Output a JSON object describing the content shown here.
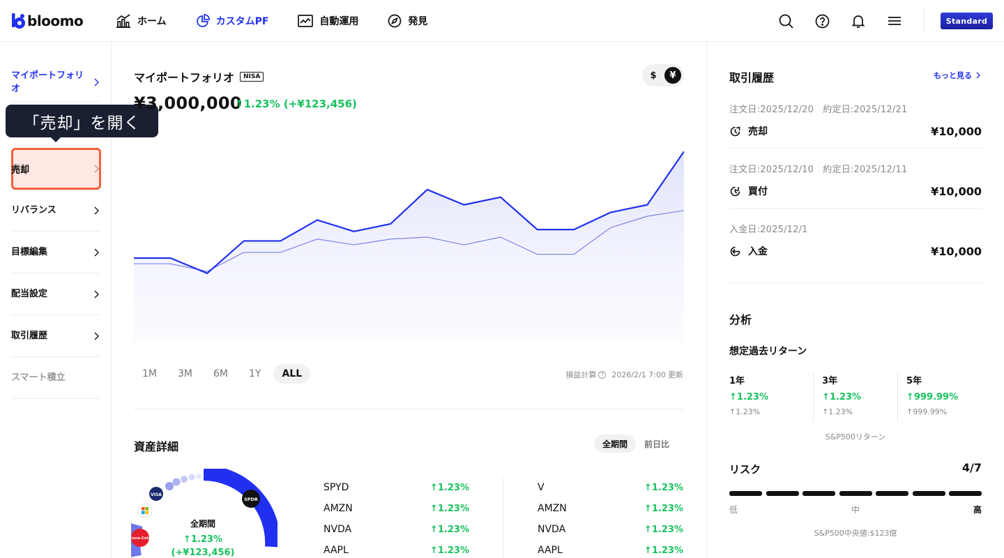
{
  "header": {
    "logo": "bloomo",
    "nav": [
      {
        "label": "ホーム",
        "icon": "home-chart-icon"
      },
      {
        "label": "カスタムPF",
        "icon": "pie-chart-icon",
        "active": true
      },
      {
        "label": "自動運用",
        "icon": "line-chart-icon"
      },
      {
        "label": "発見",
        "icon": "compass-icon"
      }
    ],
    "icons": [
      "search-icon",
      "help-icon",
      "bell-icon",
      "menu-icon"
    ],
    "plan": "Standard"
  },
  "sidebar": {
    "items": [
      {
        "label": "マイポートフォリオ",
        "state": "active"
      },
      {
        "label": "売却",
        "state": "highlighted"
      },
      {
        "label": "リバランス"
      },
      {
        "label": "目標編集"
      },
      {
        "label": "配当設定"
      },
      {
        "label": "取引履歴"
      },
      {
        "label": "スマート積立",
        "state": "disabled"
      }
    ],
    "tooltip": "「売却」を開く"
  },
  "portfolio": {
    "title": "マイポートフォリオ",
    "badge": "NISA",
    "currency": {
      "usd": "$",
      "jpy": "¥",
      "selected": "¥"
    },
    "value": "¥3,000,000",
    "change": "1.23% (+¥123,456)",
    "ranges": [
      "1M",
      "3M",
      "6M",
      "1Y",
      "ALL"
    ],
    "selected_range": "ALL",
    "pl_label": "損益計算",
    "updated": "2026/2/1 7:00",
    "updated_suffix": "更新"
  },
  "chart_data": {
    "type": "line",
    "series": [
      {
        "name": "portfolio",
        "color": "#2130f0",
        "values": [
          44,
          44,
          36,
          53,
          53,
          64,
          58,
          62,
          80,
          72,
          76,
          59,
          59,
          68,
          72,
          100
        ]
      },
      {
        "name": "benchmark",
        "color": "#7b83e6",
        "values": [
          41,
          41,
          37,
          47,
          47,
          54,
          51,
          54,
          55,
          51,
          55,
          46,
          46,
          60,
          66,
          69
        ]
      }
    ],
    "ylim": [
      0,
      110
    ],
    "grid": false
  },
  "assets": {
    "title": "資産詳細",
    "tabs": [
      "全期間",
      "前日比"
    ],
    "selected_tab": "全期間",
    "donut": {
      "label": "全期間",
      "pct": "1.23%",
      "amount": "(+¥123,456)"
    },
    "donut_logos": [
      "SPDR",
      "VISA",
      "Microsoft",
      "Coca-Cola"
    ],
    "left": [
      {
        "ticker": "SPYD",
        "change": "1.23%"
      },
      {
        "ticker": "AMZN",
        "change": "1.23%"
      },
      {
        "ticker": "NVDA",
        "change": "1.23%"
      },
      {
        "ticker": "AAPL",
        "change": "1.23%"
      }
    ],
    "right": [
      {
        "ticker": "V",
        "change": "1.23%"
      },
      {
        "ticker": "AMZN",
        "change": "1.23%"
      },
      {
        "ticker": "NVDA",
        "change": "1.23%"
      },
      {
        "ticker": "AAPL",
        "change": "1.23%"
      }
    ]
  },
  "history": {
    "title": "取引履歴",
    "more": "もっと見る",
    "items": [
      {
        "meta": "注文日:2025/12/20　約定日:2025/12/21",
        "kind": "売却",
        "amount": "¥10,000",
        "icon": "sell-icon"
      },
      {
        "meta": "注文日:2025/12/10　約定日:2025/12/11",
        "kind": "買付",
        "amount": "¥10,000",
        "icon": "buy-icon"
      },
      {
        "meta": "入金日:2025/12/1",
        "kind": "入金",
        "amount": "¥10,000",
        "icon": "deposit-icon"
      }
    ]
  },
  "analysis": {
    "title": "分析",
    "returns_title": "想定過去リターン",
    "returns": [
      {
        "year": "1年",
        "value": "1.23%",
        "sp": "1.23%"
      },
      {
        "year": "3年",
        "value": "1.23%",
        "sp": "1.23%"
      },
      {
        "year": "5年",
        "value": "999.99%",
        "sp": "999.99%"
      }
    ],
    "sp_label": "S&P500リターン",
    "risk_title": "リスク",
    "risk_value": "4/7",
    "risk_level": 4,
    "risk_max": 7,
    "risk_labels": [
      "低",
      "中",
      "高"
    ],
    "median": "S&P500中央値:$123億"
  }
}
